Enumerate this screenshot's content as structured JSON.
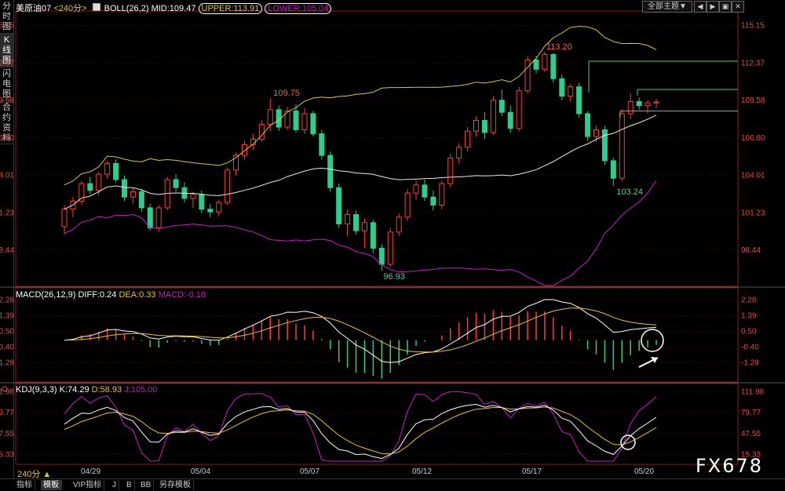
{
  "left_tabs": [
    "分时图",
    "K线图",
    "闪电图",
    "合约资料"
  ],
  "header": {
    "instrument": "美原油07",
    "period_tag": "<240分>",
    "indicator": "BOLL(26,2)",
    "mid": "MID:109.47",
    "upper": "UPPER:113.91",
    "lower": "LOWER:105.04",
    "theme_button": "全部主题▼"
  },
  "window_buttons": [
    "◀",
    "▶",
    "▣",
    "✕"
  ],
  "price_axis": [
    "115.15",
    "112.37",
    "109.58",
    "106.80",
    "104.01",
    "101.23",
    "98.44"
  ],
  "annotations": {
    "high1": "109.75",
    "high2": "113.20",
    "low1": "96.93",
    "low2": "103.24"
  },
  "macd": {
    "label": "MACD(26,12,9)",
    "diff": "DIFF:0.24",
    "dea": "DEA:0.33",
    "macd": "MACD:-0.18",
    "axis": [
      "2.28",
      "1.39",
      "0.50",
      "-0.40",
      "-1.29"
    ]
  },
  "kdj": {
    "label": "KDJ(9,3,3)",
    "k": "K:74.29",
    "d": "D:58.93",
    "j": "J:105.00",
    "axis": [
      "111.98",
      "79.77",
      "47.55",
      "15.33"
    ]
  },
  "x_dates": [
    "04/29",
    "05/04",
    "05/07",
    "05/12",
    "05/17",
    "05/20"
  ],
  "period_selector": "240分 ▲",
  "bottom_tabs": [
    "指标",
    "模板",
    "VIP指标",
    "J",
    "B",
    "BB",
    "另存模板"
  ],
  "watermark": "FX678",
  "colors": {
    "up": "#ff3b3b",
    "down": "#2ecc8f",
    "upper": "#d8c83a",
    "mid": "#e8e8e8",
    "lower": "#c51ec5",
    "kline": "#ffffff",
    "dline": "#e8c23a",
    "jline": "#c51ec5"
  },
  "chart_data": {
    "type": "candlestick",
    "instrument": "美原油07",
    "period": "240分",
    "ylim": [
      98.44,
      115.15
    ],
    "candles": [
      [
        100.2,
        101.8,
        99.6,
        101.5
      ],
      [
        101.5,
        102.4,
        100.9,
        102.1
      ],
      [
        102.1,
        103.6,
        101.8,
        103.4
      ],
      [
        103.4,
        103.9,
        102.6,
        102.9
      ],
      [
        102.9,
        104.3,
        102.5,
        104.1
      ],
      [
        104.1,
        105.1,
        103.8,
        104.9
      ],
      [
        104.9,
        105.2,
        103.5,
        103.7
      ],
      [
        103.7,
        104.0,
        102.1,
        102.4
      ],
      [
        102.4,
        103.1,
        101.9,
        102.8
      ],
      [
        102.8,
        103.0,
        101.3,
        101.6
      ],
      [
        101.6,
        101.9,
        99.9,
        100.1
      ],
      [
        100.1,
        101.8,
        99.8,
        101.6
      ],
      [
        101.6,
        103.9,
        101.4,
        103.7
      ],
      [
        103.7,
        104.1,
        102.8,
        103.1
      ],
      [
        103.1,
        103.5,
        102.0,
        102.3
      ],
      [
        102.3,
        102.8,
        101.6,
        102.6
      ],
      [
        102.6,
        102.9,
        101.2,
        101.5
      ],
      [
        101.5,
        101.9,
        100.9,
        101.3
      ],
      [
        101.3,
        102.2,
        101.0,
        102.0
      ],
      [
        102.0,
        104.6,
        101.8,
        104.4
      ],
      [
        104.4,
        105.7,
        104.0,
        105.5
      ],
      [
        105.5,
        106.6,
        105.2,
        106.3
      ],
      [
        106.3,
        107.1,
        105.9,
        106.7
      ],
      [
        106.7,
        108.1,
        106.5,
        107.8
      ],
      [
        107.8,
        109.75,
        107.3,
        108.9
      ],
      [
        108.9,
        109.2,
        107.3,
        107.6
      ],
      [
        107.6,
        109.1,
        107.4,
        108.8
      ],
      [
        108.8,
        109.3,
        107.2,
        107.4
      ],
      [
        107.4,
        109.0,
        107.1,
        108.6
      ],
      [
        108.6,
        108.8,
        106.9,
        107.1
      ],
      [
        107.1,
        107.4,
        105.2,
        105.5
      ],
      [
        105.5,
        105.8,
        102.8,
        103.1
      ],
      [
        103.1,
        103.4,
        100.1,
        100.4
      ],
      [
        100.4,
        101.5,
        99.5,
        101.1
      ],
      [
        101.1,
        101.4,
        99.6,
        99.9
      ],
      [
        99.9,
        100.8,
        98.6,
        100.5
      ],
      [
        100.5,
        100.7,
        98.2,
        98.6
      ],
      [
        98.6,
        98.9,
        96.93,
        97.4
      ],
      [
        97.4,
        100.1,
        97.2,
        99.8
      ],
      [
        99.8,
        101.2,
        99.5,
        100.9
      ],
      [
        100.9,
        103.0,
        100.6,
        102.7
      ],
      [
        102.7,
        103.6,
        102.2,
        103.3
      ],
      [
        103.3,
        103.7,
        102.1,
        102.4
      ],
      [
        102.4,
        102.9,
        101.4,
        101.8
      ],
      [
        101.8,
        103.6,
        101.5,
        103.4
      ],
      [
        103.4,
        105.6,
        103.1,
        105.3
      ],
      [
        105.3,
        106.4,
        104.9,
        106.1
      ],
      [
        106.1,
        107.6,
        105.8,
        107.3
      ],
      [
        107.3,
        108.4,
        106.9,
        108.1
      ],
      [
        108.1,
        108.7,
        106.7,
        107.2
      ],
      [
        107.2,
        109.9,
        107.0,
        109.6
      ],
      [
        109.6,
        110.4,
        108.4,
        108.7
      ],
      [
        108.7,
        109.2,
        107.2,
        107.5
      ],
      [
        107.5,
        110.6,
        107.3,
        110.3
      ],
      [
        110.3,
        112.9,
        110.1,
        112.6
      ],
      [
        112.6,
        112.9,
        111.6,
        111.9
      ],
      [
        111.9,
        113.2,
        111.7,
        113.0
      ],
      [
        113.0,
        113.1,
        110.9,
        111.2
      ],
      [
        111.2,
        111.5,
        109.6,
        109.9
      ],
      [
        109.9,
        110.8,
        109.5,
        110.6
      ],
      [
        110.6,
        110.9,
        108.3,
        108.6
      ],
      [
        108.6,
        108.8,
        106.6,
        106.9
      ],
      [
        106.9,
        107.7,
        106.5,
        107.4
      ],
      [
        107.4,
        107.7,
        104.8,
        105.1
      ],
      [
        105.1,
        105.3,
        103.24,
        103.8
      ],
      [
        103.8,
        108.9,
        103.6,
        108.6
      ],
      [
        108.6,
        110.1,
        108.2,
        109.5
      ],
      [
        109.5,
        109.8,
        108.9,
        109.2
      ],
      [
        109.2,
        109.6,
        108.6,
        109.4
      ],
      [
        109.4,
        109.7,
        109.0,
        109.47
      ]
    ],
    "boll": {
      "mid_last": 109.47,
      "upper_last": 113.91,
      "lower_last": 105.04
    },
    "macd": {
      "diff": 0.24,
      "dea": 0.33,
      "macd": -0.18,
      "ylim": [
        -1.29,
        2.28
      ]
    },
    "kdj": {
      "k": 74.29,
      "d": 58.93,
      "j": 105.0,
      "ylim": [
        15.33,
        111.98
      ]
    },
    "x_tick_labels": [
      "04/29",
      "05/04",
      "05/07",
      "05/12",
      "05/17",
      "05/20"
    ]
  }
}
